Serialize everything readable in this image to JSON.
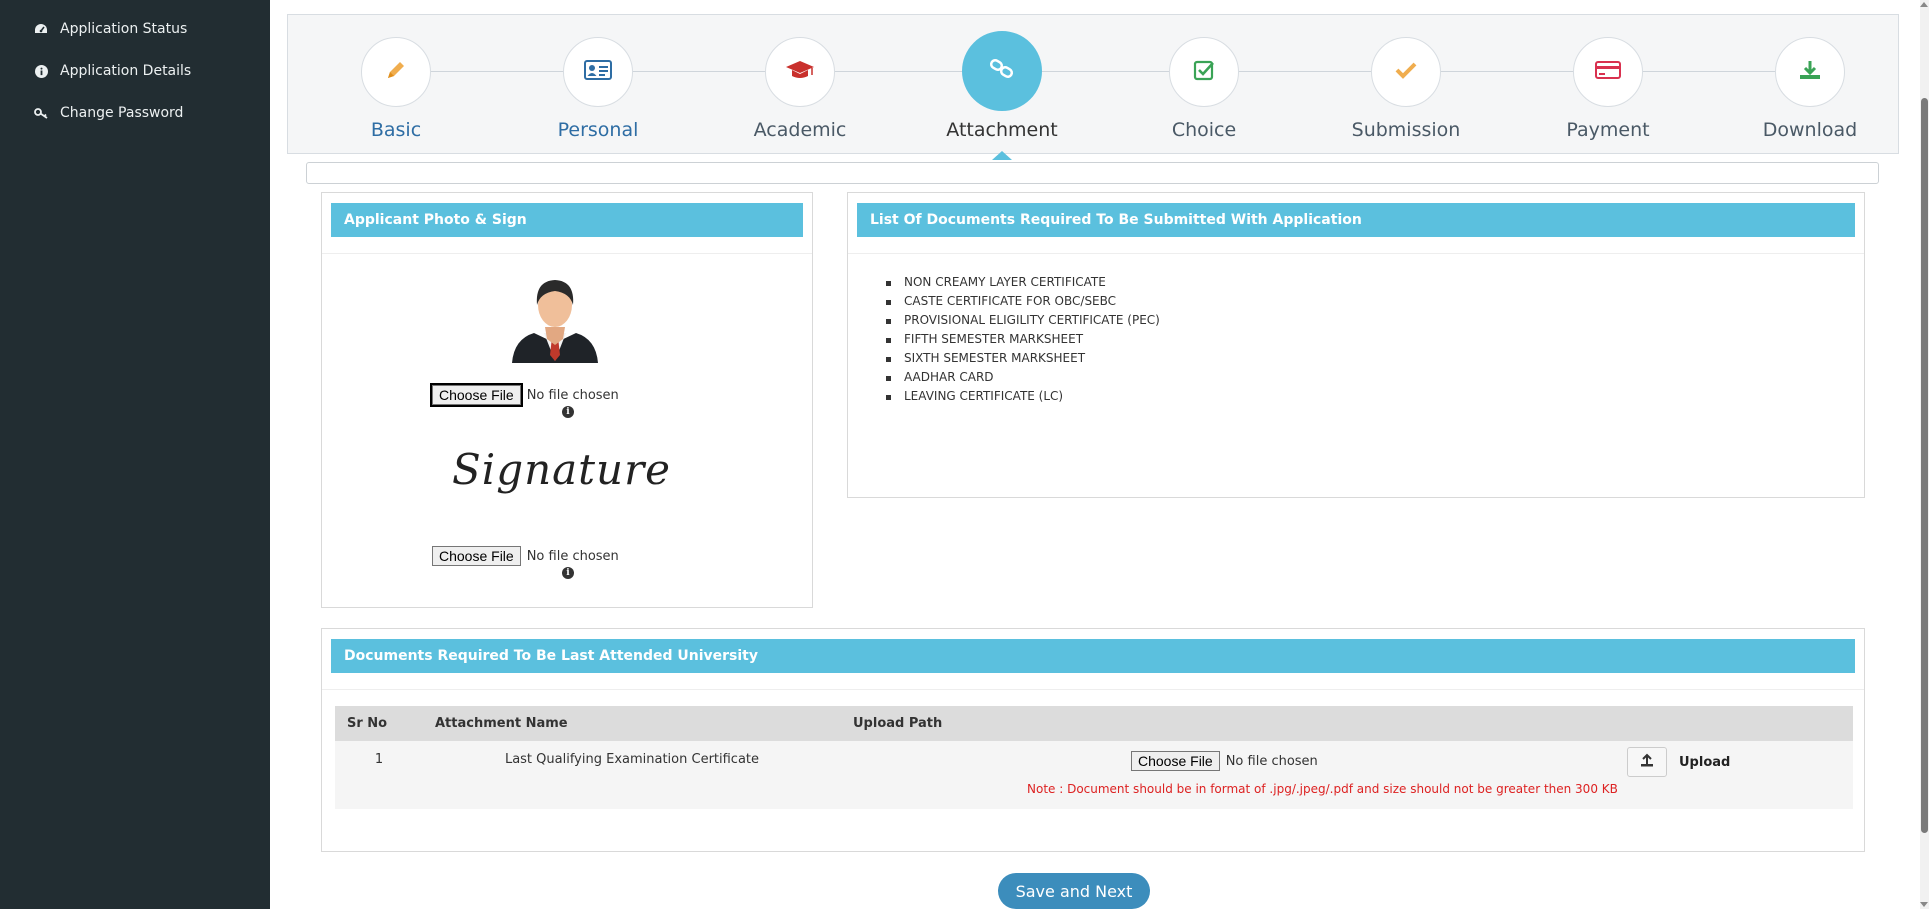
{
  "sidebar": {
    "items": [
      {
        "label": "Application Status",
        "icon": "dashboard-icon"
      },
      {
        "label": "Application Details",
        "icon": "info-circle-icon"
      },
      {
        "label": "Change Password",
        "icon": "key-icon"
      }
    ]
  },
  "wizard": {
    "steps": [
      {
        "label": "Basic",
        "icon": "pencil-icon",
        "state": "link"
      },
      {
        "label": "Personal",
        "icon": "id-card-icon",
        "state": "link"
      },
      {
        "label": "Academic",
        "icon": "graduation-cap-icon",
        "state": "normal"
      },
      {
        "label": "Attachment",
        "icon": "chain-link-icon",
        "state": "active"
      },
      {
        "label": "Choice",
        "icon": "check-square-icon",
        "state": "normal"
      },
      {
        "label": "Submission",
        "icon": "checkmark-icon",
        "state": "normal"
      },
      {
        "label": "Payment",
        "icon": "credit-card-icon",
        "state": "normal"
      },
      {
        "label": "Download",
        "icon": "download-icon",
        "state": "normal"
      }
    ]
  },
  "photo_panel": {
    "title": "Applicant Photo & Sign",
    "photo_file": {
      "button": "Choose File",
      "status": "No file chosen"
    },
    "signature_text": "Signature",
    "sign_file": {
      "button": "Choose File",
      "status": "No file chosen"
    }
  },
  "docs_panel": {
    "title": "List Of Documents Required To Be Submitted With Application",
    "items": [
      "NON CREAMY LAYER CERTIFICATE",
      "CASTE CERTIFICATE FOR OBC/SEBC",
      "PROVISIONAL ELIGILITY CERTIFICATE (PEC)",
      "FIFTH SEMESTER MARKSHEET",
      "SIXTH SEMESTER MARKSHEET",
      "AADHAR CARD",
      "LEAVING CERTIFICATE (LC)"
    ]
  },
  "university_panel": {
    "title": "Documents Required To Be Last Attended University",
    "columns": [
      "Sr No",
      "Attachment Name",
      "Upload Path"
    ],
    "rows": [
      {
        "sr": "1",
        "name": "Last Qualifying Examination Certificate",
        "file_button": "Choose File",
        "file_status": "No file chosen",
        "upload_label": "Upload",
        "note": "Note : Document should be in format of .jpg/.jpeg/.pdf and size should not be greater then 300 KB"
      }
    ]
  },
  "actions": {
    "save_next": "Save and Next"
  },
  "colors": {
    "sidebar": "#222d32",
    "accent": "#5bc0de",
    "primary": "#3c8dbc",
    "note": "#dd2222"
  }
}
